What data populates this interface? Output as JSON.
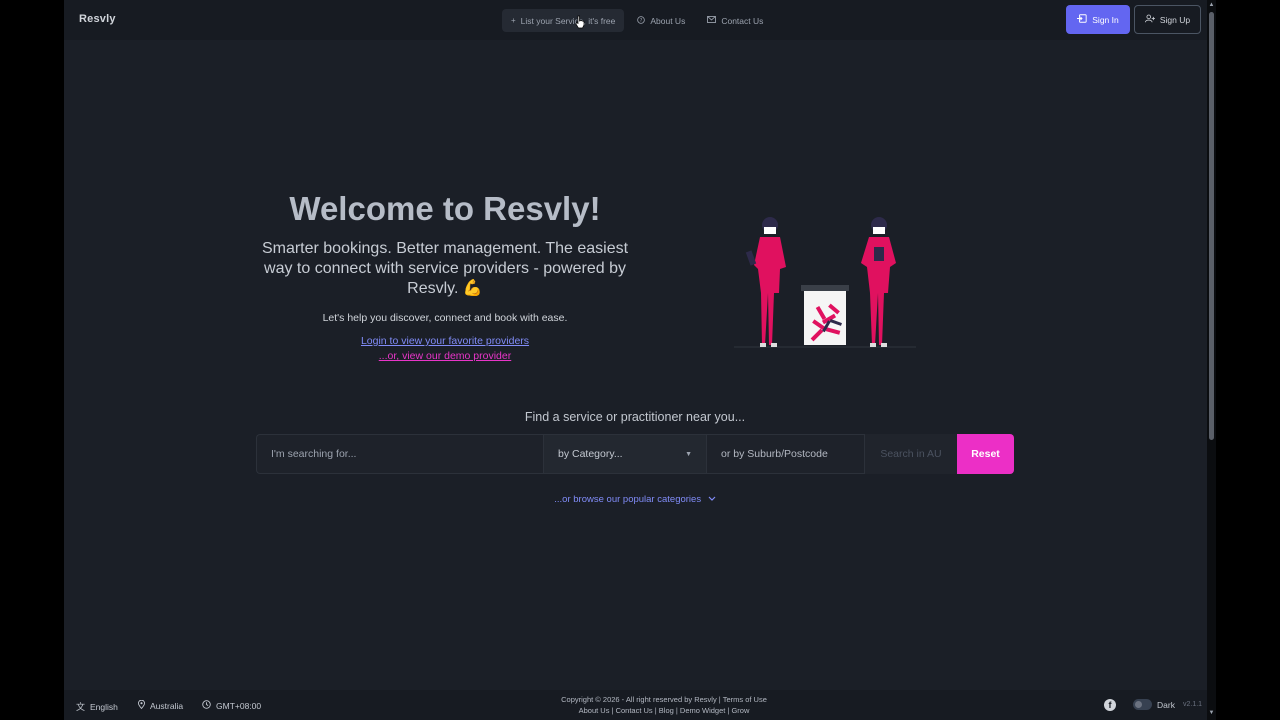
{
  "brand": "Resvly",
  "nav": {
    "list_service": "List your Service, it's free",
    "about": "About Us",
    "contact": "Contact Us"
  },
  "auth": {
    "sign_in": "Sign In",
    "sign_up": "Sign Up"
  },
  "hero": {
    "title": "Welcome to Resvly!",
    "subtitle": "Smarter bookings. Better management. The easiest way to connect with service providers - powered by Resvly. 💪",
    "help": "Let's help you discover, connect and book with ease.",
    "login_link": "Login to view your favorite providers",
    "demo_link": "...or, view our demo provider"
  },
  "search": {
    "heading": "Find a service or practitioner near you...",
    "keyword_placeholder": "I'm searching for...",
    "category_placeholder": "by Category...",
    "suburb_placeholder": "or by Suburb/Postcode",
    "search_button": "Search in AU",
    "reset_button": "Reset",
    "browse_link": "...or browse our popular categories"
  },
  "footer": {
    "language": "English",
    "country": "Australia",
    "timezone": "GMT+08:00",
    "copyright": "Copyright © 2026 - All right reserved by Resvly | Terms of Use",
    "links": "About Us | Contact Us | Blog | Demo Widget | Grow",
    "theme": "Dark",
    "version": "v2.1.1"
  },
  "colors": {
    "accent": "#6366f1",
    "pink": "#ec2fc6",
    "link": "#818cf8",
    "background": "#1b1f27"
  }
}
